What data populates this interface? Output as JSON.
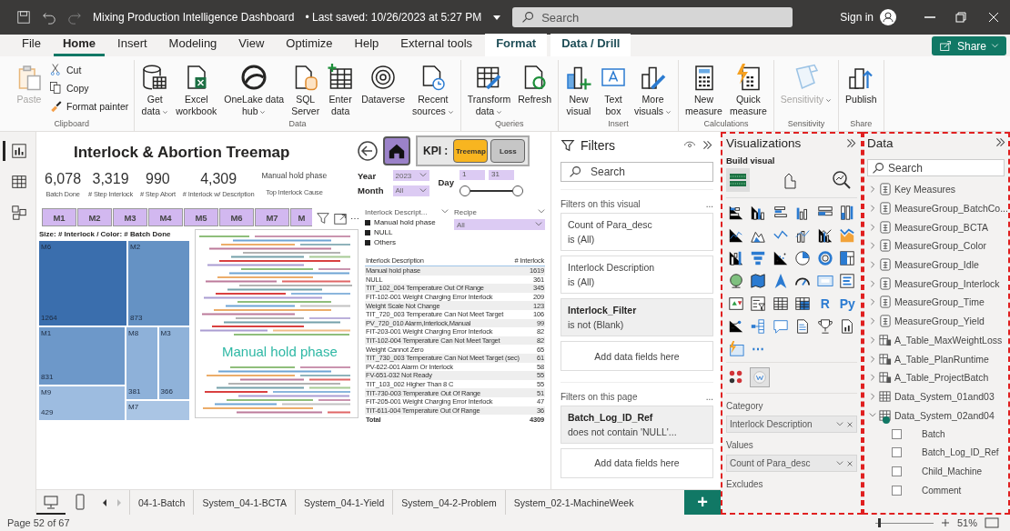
{
  "title_bar": {
    "title": "Mixing Production Intelligence Dashboard",
    "saved": "• Last saved: 10/26/2023 at 5:27 PM",
    "search": {
      "placeholder": "Search"
    },
    "sign_in": "Sign in"
  },
  "ribbon_tabs": [
    {
      "label": "File",
      "selected": false,
      "kind": "standard"
    },
    {
      "label": "Home",
      "selected": true,
      "kind": "standard"
    },
    {
      "label": "Insert",
      "selected": false,
      "kind": "standard"
    },
    {
      "label": "Modeling",
      "selected": false,
      "kind": "standard"
    },
    {
      "label": "View",
      "selected": false,
      "kind": "standard"
    },
    {
      "label": "Optimize",
      "selected": false,
      "kind": "standard"
    },
    {
      "label": "Help",
      "selected": false,
      "kind": "standard"
    },
    {
      "label": "External tools",
      "selected": false,
      "kind": "standard"
    },
    {
      "label": "Format",
      "selected": false,
      "kind": "contextual"
    },
    {
      "label": "Data / Drill",
      "selected": false,
      "kind": "contextual"
    }
  ],
  "share": "Share",
  "ribbon_groups": [
    {
      "name": "Clipboard",
      "items": [
        {
          "kind": "paste",
          "label": "Paste",
          "disabled": true,
          "dropdown": false
        }
      ],
      "stack": [
        {
          "kind": "cut",
          "label": "Cut",
          "disabled": false
        },
        {
          "kind": "copy",
          "label": "Copy",
          "disabled": false
        },
        {
          "kind": "brush",
          "label": "Format painter",
          "disabled": false
        }
      ]
    },
    {
      "name": "Data",
      "items": [
        {
          "kind": "database",
          "label": "Get\ndata",
          "dropdown": true,
          "disabled": false
        },
        {
          "kind": "excel",
          "label": "Excel\nworkbook",
          "dropdown": false,
          "disabled": false
        },
        {
          "kind": "onelake",
          "label": "OneLake data\nhub",
          "dropdown": true,
          "disabled": false
        },
        {
          "kind": "sql",
          "label": "SQL\nServer",
          "dropdown": false,
          "disabled": false
        },
        {
          "kind": "enter",
          "label": "Enter\ndata",
          "dropdown": false,
          "disabled": false
        },
        {
          "kind": "dataverse",
          "label": "Dataverse",
          "dropdown": false,
          "disabled": false
        },
        {
          "kind": "recent",
          "label": "Recent\nsources",
          "dropdown": true,
          "disabled": false
        }
      ]
    },
    {
      "name": "Queries",
      "items": [
        {
          "kind": "transform",
          "label": "Transform\ndata",
          "dropdown": true,
          "disabled": false
        },
        {
          "kind": "refresh",
          "label": "Refresh",
          "dropdown": false,
          "disabled": false
        }
      ]
    },
    {
      "name": "Insert",
      "items": [
        {
          "kind": "newvisual",
          "label": "New\nvisual",
          "dropdown": false,
          "disabled": false
        },
        {
          "kind": "textbox",
          "label": "Text\nbox",
          "dropdown": false,
          "disabled": false
        },
        {
          "kind": "morevisuals",
          "label": "More\nvisuals",
          "dropdown": true,
          "disabled": false
        }
      ]
    },
    {
      "name": "Calculations",
      "items": [
        {
          "kind": "calculator",
          "label": "New\nmeasure",
          "dropdown": false,
          "disabled": false
        },
        {
          "kind": "quick",
          "label": "Quick\nmeasure",
          "dropdown": false,
          "disabled": false
        }
      ]
    },
    {
      "name": "Sensitivity",
      "items": [
        {
          "kind": "sensitivity",
          "label": "Sensitivity",
          "dropdown": true,
          "disabled": true
        }
      ]
    },
    {
      "name": "Share",
      "items": [
        {
          "kind": "publish",
          "label": "Publish",
          "dropdown": false,
          "disabled": false
        }
      ]
    }
  ],
  "views": [
    {
      "kind": "report",
      "selected": true
    },
    {
      "kind": "table",
      "selected": false
    },
    {
      "kind": "model",
      "selected": false
    }
  ],
  "report": {
    "title": "Interlock & Abortion Treemap",
    "kpis": [
      {
        "value": "6,078",
        "label": "Batch Done"
      },
      {
        "value": "3,319",
        "label": "# Step Interlock"
      },
      {
        "value": "990",
        "label": "# Step Abort"
      },
      {
        "value": "4,309",
        "label": "# Interlock w/ Description"
      }
    ],
    "top_cause": {
      "value": "Manual hold phase",
      "label": "Top Interlock Cause"
    },
    "kpi_switch": {
      "label": "KPI :",
      "options": [
        {
          "label": "Treemap",
          "selected": true
        },
        {
          "label": "Loss",
          "selected": false
        }
      ]
    },
    "year": {
      "label": "Year",
      "value": "2023"
    },
    "month": {
      "label": "Month",
      "value": "All"
    },
    "day": {
      "label": "Day",
      "from": "1",
      "to": "31",
      "level": 1
    },
    "machines": [
      {
        "label": "M1"
      },
      {
        "label": "M2"
      },
      {
        "label": "M3"
      },
      {
        "label": "M4"
      },
      {
        "label": "M5"
      },
      {
        "label": "M6"
      },
      {
        "label": "M7"
      },
      {
        "label": "M"
      }
    ],
    "visual_menu": "⋯",
    "treemap": {
      "title": "Size: # Interlock / Color: # Batch Done",
      "cells": [
        {
          "label": "M6",
          "count": "1264",
          "color": "#3a6ead"
        },
        {
          "label": "M2",
          "count": "873",
          "color": "#6592c4"
        },
        {
          "label": "M1",
          "count": "831",
          "color": "#6d98c9"
        },
        {
          "label": "M8",
          "count": "381",
          "color": "#8eb1d9"
        },
        {
          "label": "M3",
          "count": "366",
          "color": "#8fb2d9"
        },
        {
          "label": "M9",
          "count": "429",
          "color": "#9dbce0"
        },
        {
          "label": "M7",
          "color": "#aac5e4"
        }
      ]
    },
    "word_cloud": {
      "top_word": "Manual hold phase"
    },
    "legend": {
      "title": "Interlock Descript...",
      "items": [
        {
          "label": "Manual hold phase"
        },
        {
          "label": "NULL"
        },
        {
          "label": "Others"
        }
      ]
    },
    "recipe": {
      "label": "Recipe",
      "value": "All"
    },
    "table": {
      "columns": [
        "Interlock Description",
        "# Interlock"
      ],
      "rows": [
        [
          "Manual hold phase",
          "1619"
        ],
        [
          "NULL",
          "361"
        ],
        [
          "TIT_102_004 Temperature Out Of Range",
          "345"
        ],
        [
          "FIT-102-001 Weight Charging Error Interlock",
          "209"
        ],
        [
          "Weight Scale Not Change",
          "123"
        ],
        [
          "TIT_720_003 Temperature Can Not Meet Target",
          "106"
        ],
        [
          "PV_720_010 Alarm,Interlock,Manual",
          "99"
        ],
        [
          "FIT-203-001 Weight Charging Error Interlock",
          "82"
        ],
        [
          "TIT-102-004 Temperature Can Not Meet Target",
          "82"
        ],
        [
          "Weight Cannot Zero",
          "65"
        ],
        [
          "TIT_730_003 Temperature Can Not Meet Target (sec)",
          "61"
        ],
        [
          "PV-622-001 Alarm Or Interlock",
          "58"
        ],
        [
          "FV-651-032 Not Ready",
          "55"
        ],
        [
          "TIT_103_002 Higher Than 8 C",
          "55"
        ],
        [
          "TIT-730-003 Temperature Out Of Range",
          "51"
        ],
        [
          "FIT-205-001 Weight Charging Error Interlock",
          "47"
        ],
        [
          "TIT-611-004 Temperature Out Of Range",
          "36"
        ]
      ],
      "total": [
        "Total",
        "4309"
      ]
    }
  },
  "filters": {
    "title": "Filters",
    "search": {
      "placeholder": "Search"
    },
    "sections": [
      {
        "title": "Filters on this visual",
        "more": "...",
        "cards": [
          {
            "field": "Count of Para_desc",
            "condition": "is (All)",
            "applied": false
          },
          {
            "field": "Interlock Description",
            "condition": "is (All)",
            "applied": false
          },
          {
            "field": "Interlock_Filter",
            "condition": "is not (Blank)",
            "applied": true
          }
        ],
        "add": "Add data fields here"
      },
      {
        "title": "Filters on this page",
        "more": "...",
        "cards": [
          {
            "field": "Batch_Log_ID_Ref",
            "condition": "does not contain 'NULL'...",
            "applied": true
          }
        ],
        "add": "Add data fields here"
      }
    ]
  },
  "visualizations": {
    "title": "Visualizations",
    "subtitle": "Build visual",
    "modes": [
      {
        "kind": "build",
        "selected": true
      },
      {
        "kind": "format",
        "selected": false
      },
      {
        "kind": "analytics",
        "selected": false
      }
    ],
    "gallery": [
      {
        "kind": "hbar"
      },
      {
        "kind": "vbar"
      },
      {
        "kind": "hbar2"
      },
      {
        "kind": "vbar2"
      },
      {
        "kind": "hbar3"
      },
      {
        "kind": "vbar3"
      },
      {
        "kind": "line"
      },
      {
        "kind": "area"
      },
      {
        "kind": "area2"
      },
      {
        "kind": "linecol"
      },
      {
        "kind": "linecol2"
      },
      {
        "kind": "ribbon"
      },
      {
        "kind": "waterfall"
      },
      {
        "kind": "funnel"
      },
      {
        "kind": "scatter"
      },
      {
        "kind": "pie"
      },
      {
        "kind": "donut"
      },
      {
        "kind": "treemap"
      },
      {
        "kind": "globe"
      },
      {
        "kind": "map"
      },
      {
        "kind": "arrow"
      },
      {
        "kind": "gauge"
      },
      {
        "kind": "card"
      },
      {
        "kind": "multicard"
      },
      {
        "kind": "kpi"
      },
      {
        "kind": "slicer"
      },
      {
        "kind": "table"
      },
      {
        "kind": "matrix"
      },
      {
        "kind": "glyph",
        "text": "R"
      },
      {
        "kind": "glyph",
        "text": "Py"
      },
      {
        "kind": "decomp"
      },
      {
        "kind": "keyinf"
      },
      {
        "kind": "qna"
      },
      {
        "kind": "paginated"
      },
      {
        "kind": "trophy"
      },
      {
        "kind": "report"
      },
      {
        "kind": "smart"
      },
      {
        "kind": "glyph",
        "text": "⋯"
      }
    ],
    "custom": [
      {
        "kind": "dots",
        "selected": false
      },
      {
        "kind": "wordcloud",
        "selected": true
      }
    ],
    "wells": [
      {
        "title": "Category",
        "field": "Interlock Description"
      },
      {
        "title": "Values",
        "field": "Count of Para_desc"
      },
      {
        "title": "Excludes"
      }
    ]
  },
  "data": {
    "title": "Data",
    "search": {
      "placeholder": "Search"
    },
    "items": [
      {
        "kind": "measures",
        "label": "Key Measures",
        "expanded": false
      },
      {
        "kind": "measures",
        "label": "MeasureGroup_BatchCo...",
        "expanded": false
      },
      {
        "kind": "measures",
        "label": "MeasureGroup_BCTA",
        "expanded": false
      },
      {
        "kind": "measures",
        "label": "MeasureGroup_Color",
        "expanded": false
      },
      {
        "kind": "measures",
        "label": "MeasureGroup_Idle",
        "expanded": false
      },
      {
        "kind": "measures",
        "label": "MeasureGroup_Interlock",
        "expanded": false
      },
      {
        "kind": "measures",
        "label": "MeasureGroup_Time",
        "expanded": false
      },
      {
        "kind": "measures",
        "label": "MeasureGroup_Yield",
        "expanded": false
      },
      {
        "kind": "calc_table",
        "label": "A_Table_MaxWeightLoss",
        "expanded": false
      },
      {
        "kind": "calc_table",
        "label": "A_Table_PlanRuntime",
        "expanded": false
      },
      {
        "kind": "calc_table",
        "label": "A_Table_ProjectBatch",
        "expanded": false
      },
      {
        "kind": "table",
        "label": "Data_System_01and03",
        "expanded": false
      },
      {
        "kind": "table",
        "label": "Data_System_02and04",
        "expanded": true,
        "in_use": true,
        "children": [
          {
            "label": "Batch",
            "checked": false
          },
          {
            "label": "Batch_Log_ID_Ref",
            "checked": false
          },
          {
            "label": "Child_Machine",
            "checked": false
          },
          {
            "label": "Comment",
            "checked": false
          }
        ]
      }
    ]
  },
  "layouts": [
    {
      "kind": "desktop",
      "selected": true
    },
    {
      "kind": "mobile",
      "selected": false
    }
  ],
  "pages": [
    {
      "label": "04-1-Batch"
    },
    {
      "label": "System_04-1-BCTA"
    },
    {
      "label": "System_04-1-Yield"
    },
    {
      "label": "System_04-2-Problem"
    },
    {
      "label": "System_02-1-MachineWeek"
    }
  ],
  "add_page": "+",
  "status": {
    "page": "Page 52 of 67",
    "zoom_slider": {
      "level": 0.05
    },
    "zoom": "51%"
  }
}
